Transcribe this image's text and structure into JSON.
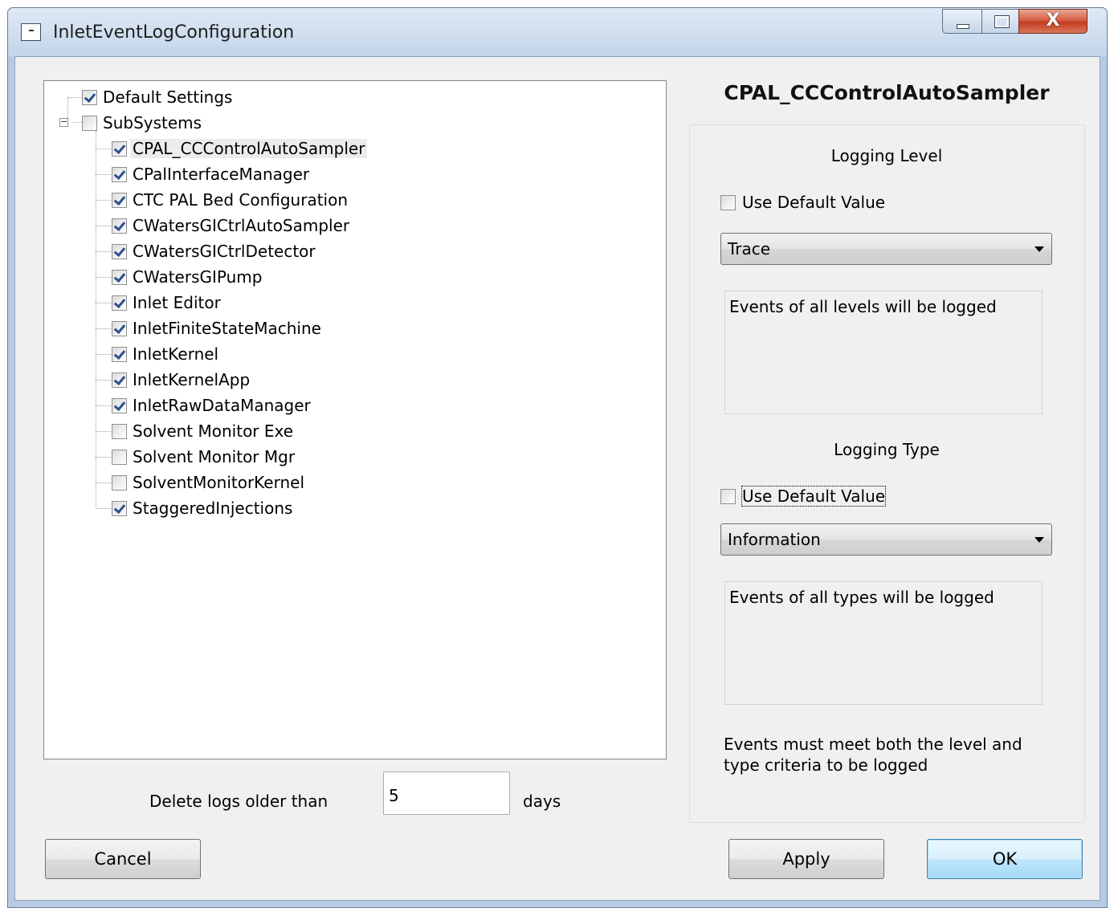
{
  "window": {
    "title": "InletEventLogConfiguration",
    "close_glyph": "X"
  },
  "tree": {
    "root_items": [
      {
        "label": "Default Settings",
        "checked": true
      },
      {
        "label": "SubSystems",
        "checked": false,
        "expanded": true
      }
    ],
    "subsystems": [
      {
        "label": "CPAL_CCControlAutoSampler",
        "checked": true,
        "selected": true
      },
      {
        "label": "CPalInterfaceManager",
        "checked": true
      },
      {
        "label": "CTC PAL Bed Configuration",
        "checked": true
      },
      {
        "label": "CWatersGICtrlAutoSampler",
        "checked": true
      },
      {
        "label": "CWatersGICtrlDetector",
        "checked": true
      },
      {
        "label": "CWatersGIPump",
        "checked": true
      },
      {
        "label": "Inlet Editor",
        "checked": true
      },
      {
        "label": "InletFiniteStateMachine",
        "checked": true
      },
      {
        "label": "InletKernel",
        "checked": true
      },
      {
        "label": "InletKernelApp",
        "checked": true
      },
      {
        "label": "InletRawDataManager",
        "checked": true
      },
      {
        "label": "Solvent Monitor Exe",
        "checked": false
      },
      {
        "label": "Solvent Monitor Mgr",
        "checked": false
      },
      {
        "label": "SolventMonitorKernel",
        "checked": false
      },
      {
        "label": "StaggeredInjections",
        "checked": true
      }
    ]
  },
  "retention": {
    "label": "Delete logs older than",
    "value": "5",
    "unit": "days"
  },
  "details": {
    "subsystem_name": "CPAL_CCControlAutoSampler",
    "logging_level": {
      "heading": "Logging Level",
      "use_default_label": "Use Default Value",
      "use_default_checked": false,
      "selected": "Trace",
      "description": "Events of all levels will be logged"
    },
    "logging_type": {
      "heading": "Logging Type",
      "use_default_label": "Use Default Value",
      "use_default_checked": false,
      "selected": "Information",
      "description": "Events of all types will be logged"
    },
    "criteria_note": "Events must meet both the level and type criteria to be logged"
  },
  "buttons": {
    "cancel": "Cancel",
    "apply": "Apply",
    "ok": "OK"
  }
}
